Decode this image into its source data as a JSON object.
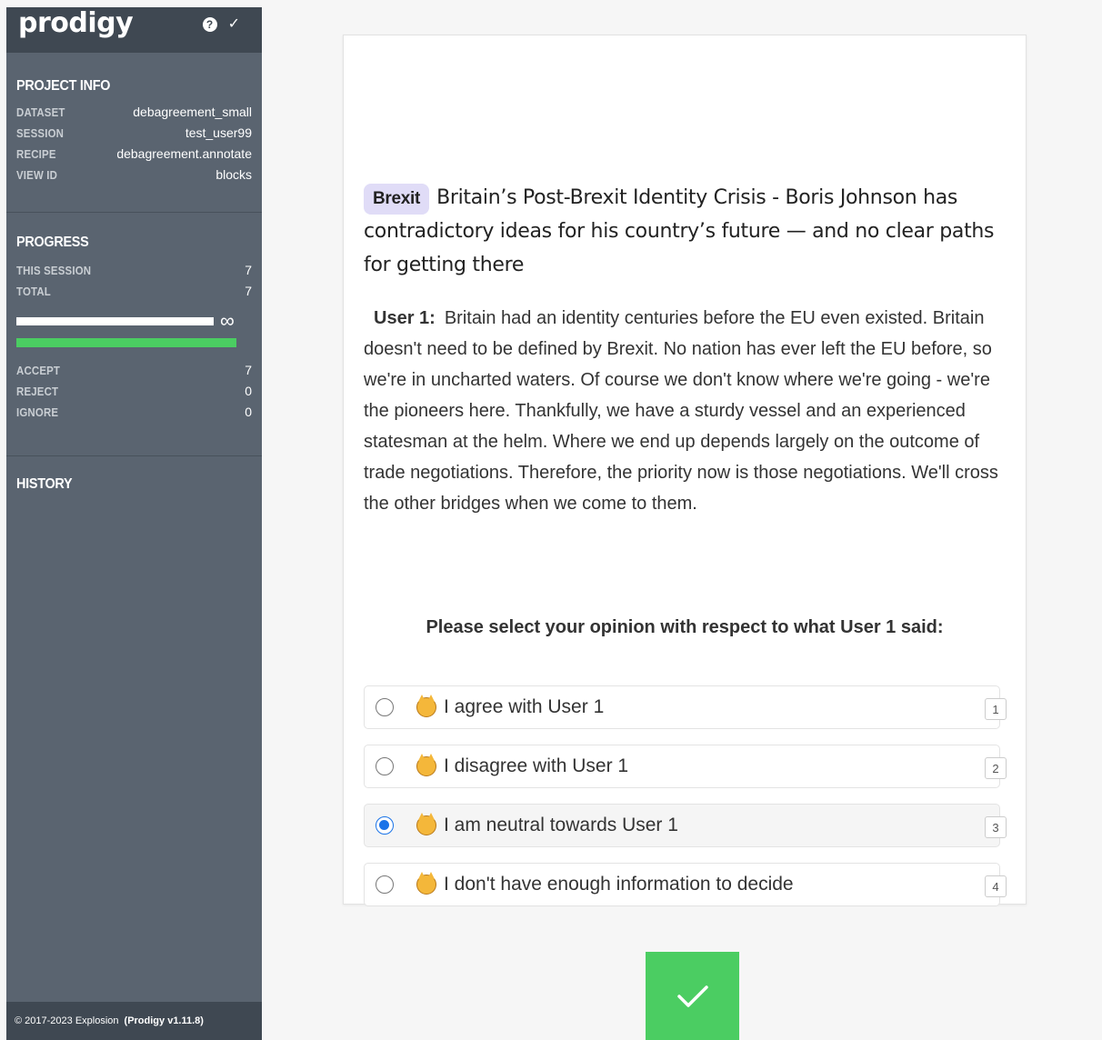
{
  "app": {
    "logo": "prodigy",
    "help_glyph": "?",
    "check_glyph": "✓"
  },
  "project_info": {
    "title": "PROJECT INFO",
    "rows": [
      {
        "key": "DATASET",
        "value": "debagreement_small"
      },
      {
        "key": "SESSION",
        "value": "test_user99"
      },
      {
        "key": "RECIPE",
        "value": "debagreement.annotate"
      },
      {
        "key": "VIEW ID",
        "value": "blocks"
      }
    ]
  },
  "progress": {
    "title": "PROGRESS",
    "this_session_label": "THIS SESSION",
    "this_session_value": "7",
    "total_label": "TOTAL",
    "total_value": "7",
    "infinity": "∞",
    "counts": [
      {
        "key": "ACCEPT",
        "value": "7"
      },
      {
        "key": "REJECT",
        "value": "0"
      },
      {
        "key": "IGNORE",
        "value": "0"
      }
    ]
  },
  "history": {
    "title": "HISTORY"
  },
  "footer": {
    "copyright": "© 2017-2023 Explosion",
    "version": "(Prodigy v1.11.8)"
  },
  "task": {
    "tag": "Brexit",
    "title": "Britain’s Post-Brexit Identity Crisis - Boris Johnson has contradictory ideas for his country’s future — and no clear paths for getting there",
    "user_label": "User 1:",
    "body": "Britain had an identity centuries before the EU even existed. Britain doesn't need to be defined by Brexit. No nation has ever left the EU before, so we're in uncharted waters. Of course we don't know where we're going - we're the pioneers here. Thankfully, we have a sturdy vessel and an experienced statesman at the helm. Where we end up depends largely on the outcome of trade negotiations. Therefore, the priority now is those negotiations. We'll cross the other bridges when we come to them.",
    "question": "Please select your opinion with respect to what User 1 said:",
    "options": [
      {
        "label": "I agree with User 1",
        "key": "1",
        "icon": "smiling-cat-icon",
        "selected": false
      },
      {
        "label": "I disagree with User 1",
        "key": "2",
        "icon": "pouting-cat-icon",
        "selected": false
      },
      {
        "label": "I am neutral towards User 1",
        "key": "3",
        "icon": "neutral-cat-icon",
        "selected": true
      },
      {
        "label": "I don't have enough information to decide",
        "key": "4",
        "icon": "weary-cat-icon",
        "selected": false
      }
    ]
  },
  "colors": {
    "sidebar": "#5a6470",
    "sidebar_dark": "#3f4852",
    "accent_green": "#4bcd62",
    "tag_bg": "#e0dcf7",
    "radio_blue": "#1a73e8"
  }
}
